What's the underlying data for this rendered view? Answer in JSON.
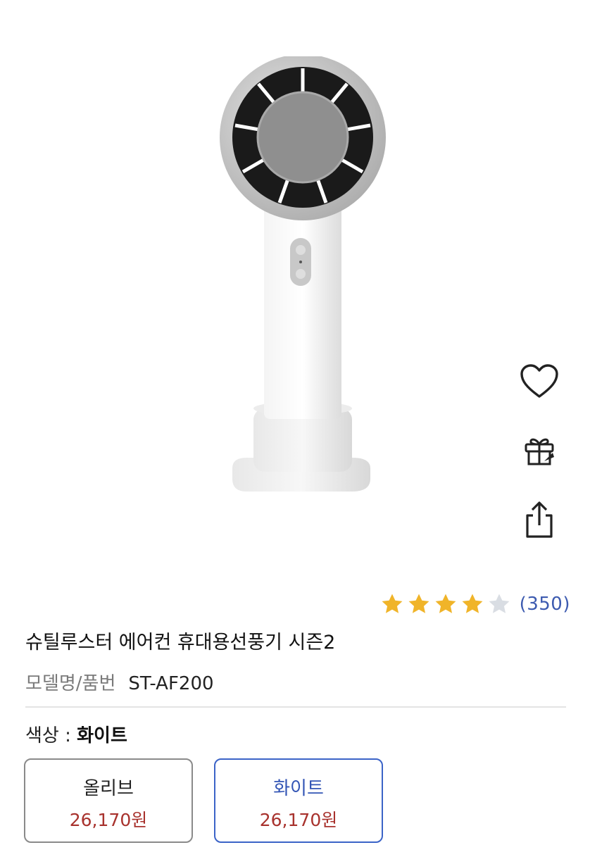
{
  "product": {
    "title": "슈틸루스터 에어컨 휴대용선풍기 시즌2",
    "model_label": "모델명/품번",
    "model_value": "ST-AF200"
  },
  "rating": {
    "stars": 4,
    "max_stars": 5,
    "review_count": "(350)",
    "star_color": "#f0b429",
    "empty_star_color": "#d9dde3"
  },
  "actions": {
    "wishlist_icon": "heart-icon",
    "gift_icon": "gift-icon",
    "share_icon": "share-icon"
  },
  "color_selection": {
    "label": "색상 : ",
    "selected": "화이트"
  },
  "options": [
    {
      "name": "올리브",
      "price": "26,170원",
      "selected": false
    },
    {
      "name": "화이트",
      "price": "26,170원",
      "selected": true
    }
  ],
  "colors": {
    "accent": "#3b63c7",
    "price": "#a8322d",
    "review_link": "#3d5bb0"
  }
}
